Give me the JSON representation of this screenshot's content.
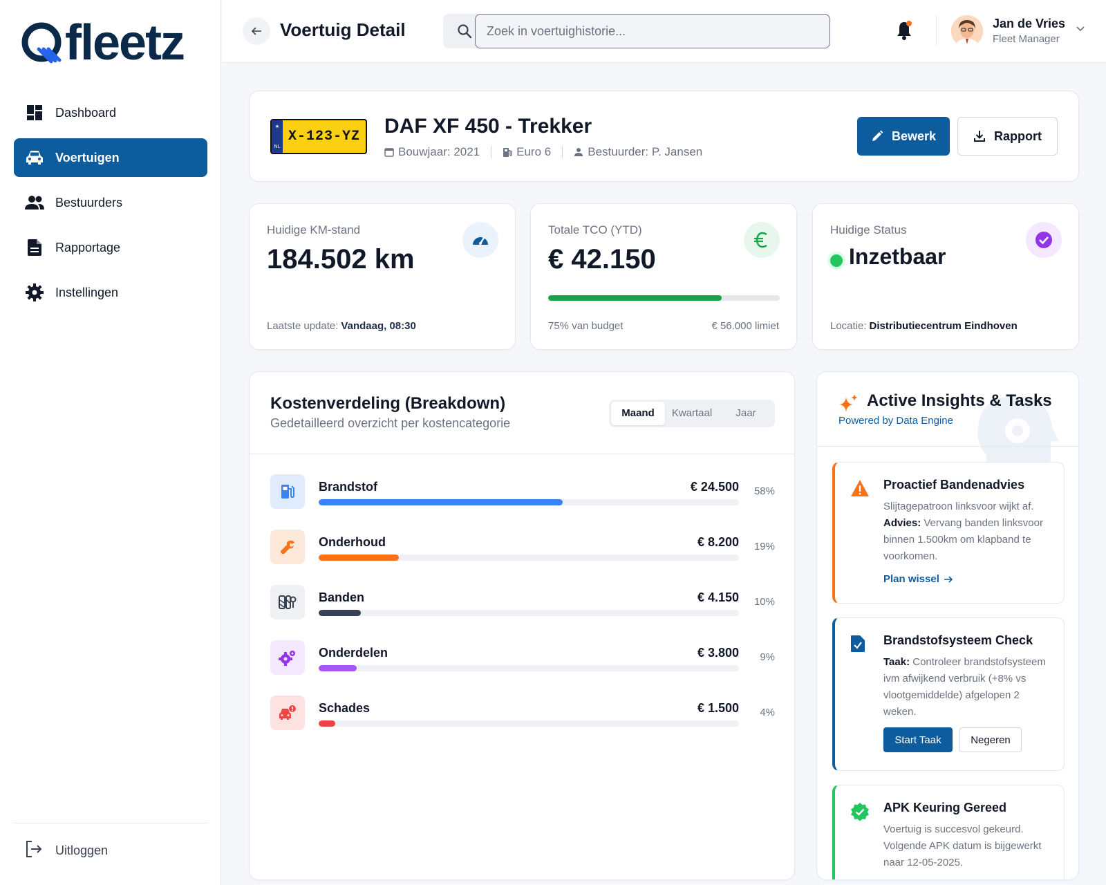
{
  "brand": {
    "name": "fleetz"
  },
  "sidebar": {
    "items": [
      {
        "label": "Dashboard",
        "icon": "dashboard-icon"
      },
      {
        "label": "Voertuigen",
        "icon": "car-icon"
      },
      {
        "label": "Bestuurders",
        "icon": "users-icon"
      },
      {
        "label": "Rapportage",
        "icon": "document-icon"
      },
      {
        "label": "Instellingen",
        "icon": "gear-icon"
      }
    ],
    "logout_label": "Uitloggen"
  },
  "header": {
    "title": "Voertuig Detail",
    "search_placeholder": "Zoek in voertuighistorie...",
    "user_name": "Jan de Vries",
    "user_role": "Fleet Manager"
  },
  "vehicle": {
    "plate": "X-123-YZ",
    "plate_country": "NL",
    "title": "DAF XF 450 - Trekker",
    "year": "Bouwjaar: 2021",
    "emission": "Euro 6",
    "driver": "Bestuurder: P. Jansen",
    "edit_label": "Bewerk",
    "report_label": "Rapport"
  },
  "stats": {
    "km": {
      "label": "Huidige KM-stand",
      "value": "184.502 km",
      "foot_label": "Laatste update:",
      "foot_value": "Vandaag, 08:30"
    },
    "tco": {
      "label": "Totale TCO (YTD)",
      "value": "€ 42.150",
      "budget_fraction": 0.75,
      "budget_text": "75% van budget",
      "limit_text": "€ 56.000 limiet"
    },
    "status": {
      "label": "Huidige Status",
      "value": "Inzetbaar",
      "foot_label": "Locatie:",
      "foot_value": "Distributiecentrum Eindhoven"
    }
  },
  "breakdown": {
    "title": "Kostenverdeling (Breakdown)",
    "subtitle": "Gedetailleerd overzicht per kostencategorie",
    "periods": [
      "Maand",
      "Kwartaal",
      "Jaar"
    ],
    "active_period": "Maand",
    "rows": [
      {
        "name": "Brandstof",
        "amount": "€ 24.500",
        "pct": "58%",
        "fraction": 0.58,
        "color": "#3b82f6",
        "bg": "#e0ecfd",
        "icon": "fuel-icon"
      },
      {
        "name": "Onderhoud",
        "amount": "€ 8.200",
        "pct": "19%",
        "fraction": 0.19,
        "color": "#f97316",
        "bg": "#fde8da",
        "icon": "wrench-icon"
      },
      {
        "name": "Banden",
        "amount": "€ 4.150",
        "pct": "10%",
        "fraction": 0.1,
        "color": "#374151",
        "bg": "#eef0f4",
        "icon": "tire-icon"
      },
      {
        "name": "Onderdelen",
        "amount": "€ 3.800",
        "pct": "9%",
        "fraction": 0.09,
        "color": "#a855f7",
        "bg": "#f3e8ff",
        "icon": "parts-icon"
      },
      {
        "name": "Schades",
        "amount": "€ 1.500",
        "pct": "4%",
        "fraction": 0.04,
        "color": "#ef4444",
        "bg": "#fde2e2",
        "icon": "car-damage-icon"
      }
    ]
  },
  "insights": {
    "title": "Active Insights & Tasks",
    "subtitle": "Powered by Data Engine",
    "tasks": [
      {
        "title": "Proactief Bandenadvies",
        "line1": "Slijtagepatroon linksvoor wijkt af.",
        "bold": "Advies:",
        "line2": "Vervang banden linksvoor binnen 1.500km om klapband te voorkomen.",
        "link": "Plan wissel",
        "accent": "#f97316"
      },
      {
        "title": "Brandstofsysteem Check",
        "bold": "Taak:",
        "line2": "Controleer brandstofsysteem ivm afwijkend verbruik (+8% vs vlootgemiddelde) afgelopen 2 weken.",
        "primary": "Start Taak",
        "secondary": "Negeren",
        "accent": "#0d5c9e"
      },
      {
        "title": "APK Keuring Gereed",
        "line2": "Voertuig is succesvol gekeurd. Volgende APK datum is bijgewerkt naar 12-05-2025.",
        "accent": "#22c55e"
      }
    ]
  }
}
